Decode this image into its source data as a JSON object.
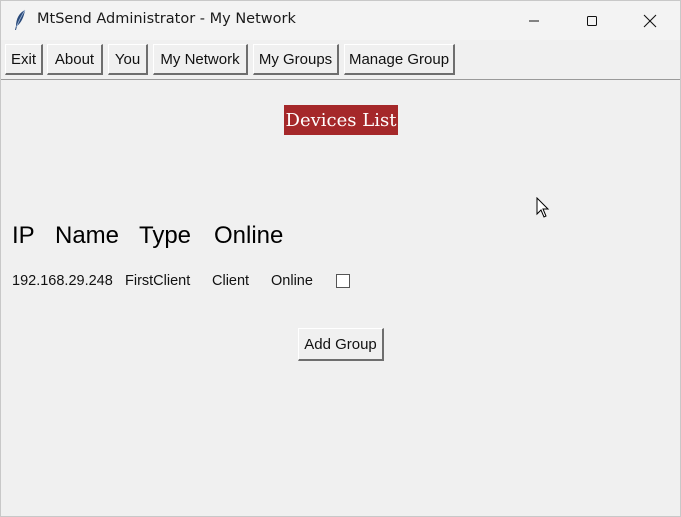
{
  "window": {
    "title": "MtSend Administrator - My Network",
    "controls": {
      "minimize_icon": "minimize-icon",
      "maximize_icon": "maximize-icon",
      "close_icon": "close-icon"
    }
  },
  "toolbar": {
    "buttons": [
      {
        "label": "Exit"
      },
      {
        "label": "About"
      },
      {
        "label": "You"
      },
      {
        "label": "My Network"
      },
      {
        "label": "My Groups"
      },
      {
        "label": "Manage Group"
      }
    ]
  },
  "main": {
    "title": "Devices List",
    "title_bg": "#a5282a",
    "headers": [
      "IP",
      "Name",
      "Type",
      "Online"
    ],
    "rows": [
      {
        "ip": "192.168.29.248",
        "name": "FirstClient",
        "type": "Client",
        "online": "Online",
        "checked": false
      }
    ],
    "add_group_label": "Add Group"
  }
}
